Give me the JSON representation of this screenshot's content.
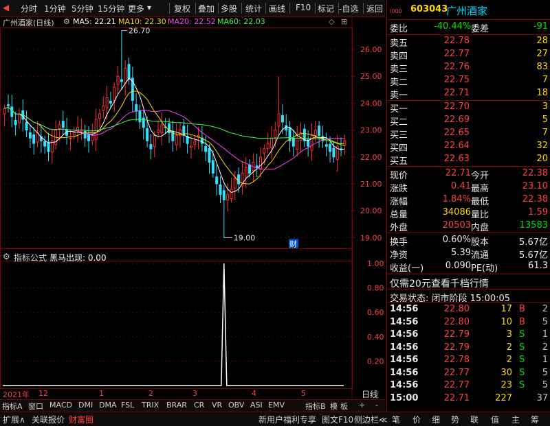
{
  "toolbar": {
    "items": [
      "分时",
      "1分钟",
      "5分钟",
      "15分钟",
      "更多",
      "复权",
      "叠加",
      "多股",
      "统计",
      "画线",
      "F10",
      "标记",
      "-自选",
      "返回"
    ]
  },
  "chart": {
    "title": "广州酒家(日线)",
    "ma": [
      {
        "label": "MA5: 22.21",
        "color": "#ffffff"
      },
      {
        "label": "MA10: 22.30",
        "color": "#ffd800"
      },
      {
        "label": "MA20: 22.52",
        "color": "#ff40ff"
      },
      {
        "label": "MA60: 22.03",
        "color": "#40ff40"
      }
    ],
    "price_ticks": [
      "26.00",
      "25.00",
      "24.00",
      "23.00",
      "22.00",
      "21.00",
      "20.00",
      "19.00"
    ],
    "high_label": "26.70",
    "low_label": "19.00",
    "cai_badge": "财",
    "indicator_title": "指标公式",
    "indicator_name": "黑马出现: 0.00",
    "indicator_ticks": [
      "1.00",
      "0.80",
      "0.60",
      "0.40",
      "0.20"
    ],
    "date_labels": [
      "2021年",
      "12",
      "1",
      "2",
      "3",
      "4",
      "5"
    ],
    "period_label": "日线",
    "colors": {
      "up": "#ff3030",
      "down": "#30e0ff",
      "border": "#800000"
    }
  },
  "tabs1": [
    "指标A",
    "窗口",
    "MACD",
    "DMI",
    "DMA",
    "FSL",
    "TRIX",
    "BRAR",
    "CR",
    "VR",
    "OBV",
    "ASI",
    "EMV",
    "指标B",
    "模",
    "板",
    "+",
    "-"
  ],
  "tabs2": [
    "扩展∧",
    "关联报价",
    "财富圈",
    "新用户福利专享",
    "图文F10",
    "侧边栏≪",
    "笔",
    "价",
    "细",
    "势",
    "联",
    "值",
    "主",
    "筹"
  ],
  "quote": {
    "code": "603043",
    "name": "广州酒家",
    "code_prefix": "I000",
    "weibi_label": "委比",
    "weibi": "-40.44%",
    "weicha_label": "委差",
    "weicha": "-91",
    "sells": [
      {
        "label": "卖五",
        "price": "22.78",
        "vol": "28"
      },
      {
        "label": "卖四",
        "price": "22.77",
        "vol": "27"
      },
      {
        "label": "卖三",
        "price": "22.76",
        "vol": "83"
      },
      {
        "label": "卖二",
        "price": "22.75",
        "vol": "7"
      },
      {
        "label": "卖一",
        "price": "22.71",
        "vol": "18"
      }
    ],
    "buys": [
      {
        "label": "买一",
        "price": "22.70",
        "vol": "3"
      },
      {
        "label": "买二",
        "price": "22.69",
        "vol": "5"
      },
      {
        "label": "买三",
        "price": "22.65",
        "vol": "7"
      },
      {
        "label": "买四",
        "price": "22.64",
        "vol": "32"
      },
      {
        "label": "买五",
        "price": "22.63",
        "vol": "20"
      }
    ],
    "stats": [
      {
        "l1": "现价",
        "v1": "22.71",
        "c1": "red",
        "l2": "今开",
        "v2": "22.38",
        "c2": "red"
      },
      {
        "l1": "涨跌",
        "v1": "0.41",
        "c1": "red",
        "l2": "最高",
        "v2": "23.10",
        "c2": "red"
      },
      {
        "l1": "涨幅",
        "v1": "1.84%",
        "c1": "red",
        "l2": "最低",
        "v2": "22.38",
        "c2": "red"
      },
      {
        "l1": "总量",
        "v1": "34086",
        "c1": "yellow",
        "l2": "量比",
        "v2": "1.59",
        "c2": "red"
      },
      {
        "l1": "外盘",
        "v1": "20503",
        "c1": "red",
        "l2": "内盘",
        "v2": "13583",
        "c2": "green"
      }
    ],
    "stats2": [
      {
        "l1": "换手",
        "v1": "0.60%",
        "l2": "股本",
        "v2": "5.67亿"
      },
      {
        "l1": "净资",
        "v1": "5.39",
        "l2": "流通",
        "v2": "5.67亿"
      },
      {
        "l1": "收益(一)",
        "v1": "0.090",
        "l2": "PE(动)",
        "v2": "61.3"
      }
    ],
    "promo": "仅需20元查看千档行情",
    "status": "交易状态: 闭市阶段 15:00:05",
    "ticks": [
      {
        "t": "14:56",
        "p": "22.80",
        "v": "17",
        "d": "B",
        "n": "2",
        "pc": "red",
        "dc": "red"
      },
      {
        "t": "14:56",
        "p": "22.80",
        "v": "10",
        "d": "B",
        "n": "5",
        "pc": "red",
        "dc": "red"
      },
      {
        "t": "14:56",
        "p": "22.79",
        "v": "3",
        "d": "S",
        "n": "1",
        "pc": "red",
        "dc": "green"
      },
      {
        "t": "14:56",
        "p": "22.79",
        "v": "2",
        "d": "S",
        "n": "2",
        "pc": "red",
        "dc": "green"
      },
      {
        "t": "14:56",
        "p": "22.78",
        "v": "2",
        "d": "S",
        "n": "1",
        "pc": "red",
        "dc": "green"
      },
      {
        "t": "14:56",
        "p": "22.77",
        "v": "30",
        "d": "S",
        "n": "5",
        "pc": "red",
        "dc": "green"
      },
      {
        "t": "14:56",
        "p": "22.77",
        "v": "23",
        "d": "S",
        "n": "5",
        "pc": "red",
        "dc": "green"
      },
      {
        "t": "15:00",
        "p": "22.71",
        "v": "227",
        "d": "",
        "n": "37",
        "pc": "red",
        "dc": "red"
      }
    ]
  }
}
